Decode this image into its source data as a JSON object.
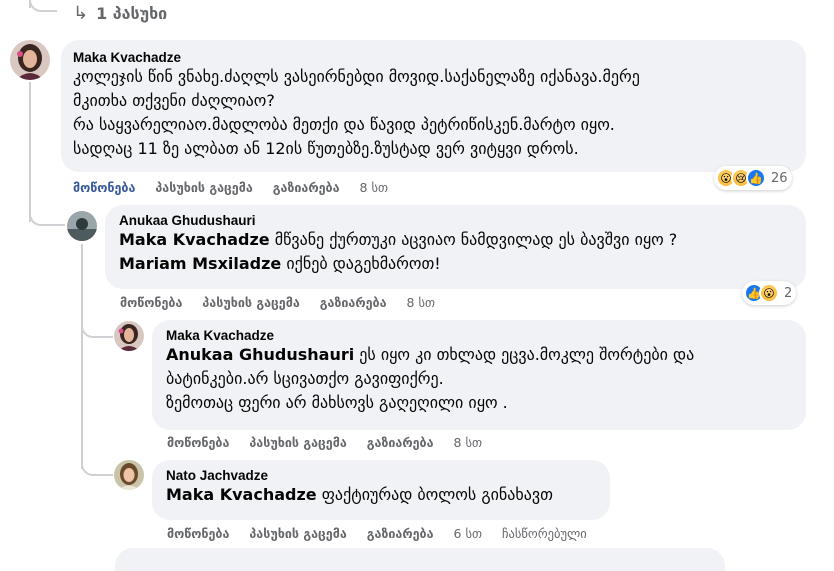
{
  "replies_link": {
    "icon": "reply-arrow-icon",
    "label": "1 პასუხი"
  },
  "actions": {
    "like": "მოწონება",
    "reply": "პასუხის გაცემა",
    "share": "გაზიარება",
    "edited": "ჩასწორებული"
  },
  "comments": [
    {
      "author": "Maka Kvachadze",
      "lines": [
        "კოლეჯის წინ ვნახე.ძაღლს ვასეირნებდი მოვიდ.საქანელაზე იქანავა.მერე",
        "მკითხა თქვენი ძაღლიაო?",
        "რა საყვარელიაო.მადლობა მეთქი და წავიდ პეტრიწისკენ.მარტო იყო.",
        "სადღაც 11 ზე ალბათ ან 12ის წუთებზე.ზუსტად ვერ ვიტყვი დროს."
      ],
      "time": "8 სთ",
      "reaction_count": "26",
      "reactions": [
        "wow",
        "sad",
        "like"
      ]
    },
    {
      "author": "Anukaa Ghudushauri",
      "line1_mention": "Maka Kvachadze",
      "line1_text": " მწვანე ქურთუკი აცვიაო ნამდვილად ეს ბავშვი იყო ?",
      "line2_mention": "Mariam Msxiladze",
      "line2_text": " იქნებ დაგეხმაროთ!",
      "time": "8 სთ",
      "reaction_count": "2",
      "reactions": [
        "like",
        "wow"
      ]
    },
    {
      "author": "Maka Kvachadze",
      "line1_mention": "Anukaa Ghudushauri",
      "line1_text": " ეს იყო კი თხლად ეცვა.მოკლე შორტები და",
      "line2": "ბატინკები.არ სცივათქო გავიფიქრე.",
      "line3": "ზემოთაც ფერი არ მახსოვს გაღეღილი იყო .",
      "time": "8 სთ"
    },
    {
      "author": "Nato Jachvadze",
      "line1_mention": "Maka Kvachadze",
      "line1_text": " ფაქტიურად ბოლოს გინახავთ",
      "time": "6 სთ"
    }
  ]
}
